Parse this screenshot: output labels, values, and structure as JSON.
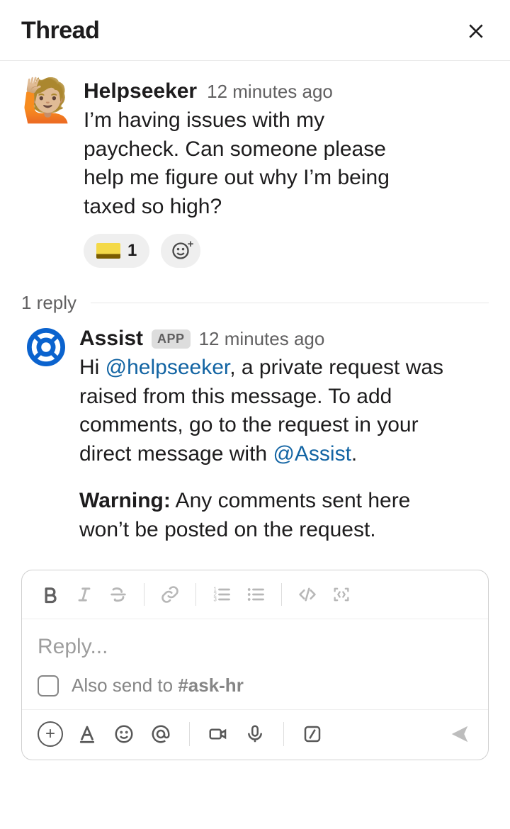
{
  "header": {
    "title": "Thread"
  },
  "message1": {
    "avatar_emoji": "🙋🏼",
    "author": "Helpseeker",
    "time": "12 minutes ago",
    "text": "I’m having issues with my paycheck. Can someone please help me figure out why I’m being taxed so high?",
    "reaction_count": "1"
  },
  "replies_label": "1 reply",
  "message2": {
    "author": "Assist",
    "badge": "APP",
    "time": "12 minutes ago",
    "greeting": "Hi ",
    "mention1": "@helpseeker",
    "mid": ",  a private request was raised from this message. To add comments, go to the request in your direct message with ",
    "mention2": "@Assist",
    "tail": ".",
    "warning_label": "Warning:",
    "warning_text": " Any comments sent here won’t be posted on the request."
  },
  "composer": {
    "placeholder": "Reply...",
    "also_send_prefix": "Also send to ",
    "also_send_channel": "#ask-hr"
  }
}
